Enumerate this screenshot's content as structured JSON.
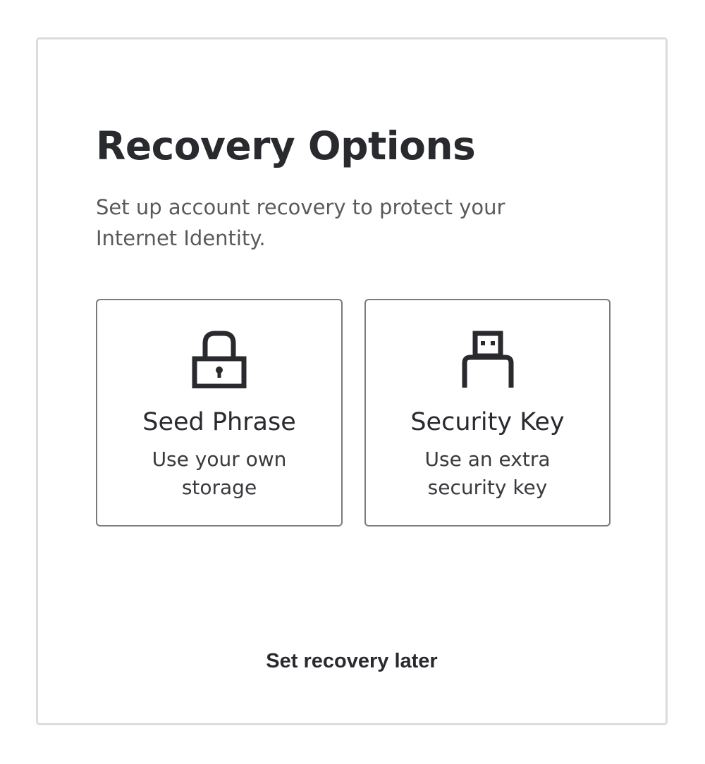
{
  "page": {
    "title": "Recovery Options",
    "subtitle": "Set up account recovery to protect your Internet Identity."
  },
  "options": [
    {
      "title": "Seed Phrase",
      "description": "Use your own storage",
      "icon": "lock-icon"
    },
    {
      "title": "Security Key",
      "description": "Use an extra security key",
      "icon": "usb-key-icon"
    }
  ],
  "actions": {
    "later_label": "Set recovery later"
  },
  "colors": {
    "text": "#292a2e",
    "subtext": "#5a5a5e",
    "card_border": "#dcdcdc",
    "option_border": "#7b7b7f",
    "background": "#ffffff"
  }
}
